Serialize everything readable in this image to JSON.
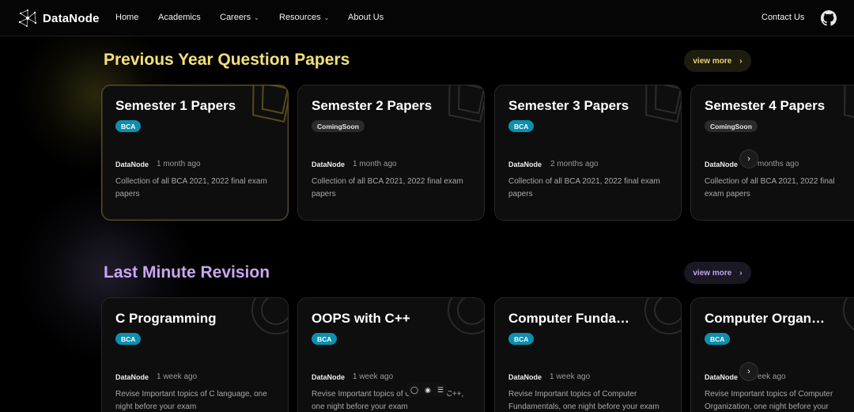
{
  "nav": {
    "brand": "DataNode",
    "items": [
      {
        "label": "Home"
      },
      {
        "label": "Academics"
      },
      {
        "label": "Careers",
        "dropdown": true
      },
      {
        "label": "Resources",
        "dropdown": true
      },
      {
        "label": "About Us"
      }
    ],
    "contact": "Contact Us",
    "github_icon": "github-icon"
  },
  "sections": [
    {
      "title": "Previous Year Question Papers",
      "view_more": "view more",
      "accent": "#f3e07a",
      "cards": [
        {
          "title": "Semester 1 Papers",
          "badge": "BCA",
          "author": "DataNode",
          "time": "1 month ago",
          "desc": "Collection of all BCA 2021, 2022 final exam papers"
        },
        {
          "title": "Semester 2 Papers",
          "badge": "ComingSoon",
          "author": "DataNode",
          "time": "1 month ago",
          "desc": "Collection of all BCA 2021, 2022 final exam papers"
        },
        {
          "title": "Semester 3 Papers",
          "badge": "BCA",
          "author": "DataNode",
          "time": "2 months ago",
          "desc": "Collection of all BCA 2021, 2022 final exam papers"
        },
        {
          "title": "Semester 4 Papers",
          "badge": "ComingSoon",
          "author": "DataNode",
          "time": "months ago",
          "desc": "Collection of all BCA 2021, 2022 final exam papers"
        }
      ]
    },
    {
      "title": "Last Minute Revision",
      "view_more": "view more",
      "accent": "#c9a6f0",
      "cards": [
        {
          "title": "C Programming",
          "badge": "BCA",
          "author": "DataNode",
          "time": "1 week ago",
          "desc": "Revise Important topics of C language, one night before your exam"
        },
        {
          "title": "OOPS with C++",
          "badge": "BCA",
          "author": "DataNode",
          "time": "1 week ago",
          "desc": "Revise Important topics of OOPS with C++, one night before your exam"
        },
        {
          "title": "Computer Funda…",
          "badge": "BCA",
          "author": "DataNode",
          "time": "1 week ago",
          "desc": "Revise Important topics of Computer Fundamentals, one night before your exam"
        },
        {
          "title": "Computer Organ…",
          "badge": "BCA",
          "author": "DataNode",
          "time": "eek ago",
          "desc": "Revise Important topics of Computer Organization, one night before your exam"
        }
      ]
    }
  ],
  "carousel_next": "›"
}
